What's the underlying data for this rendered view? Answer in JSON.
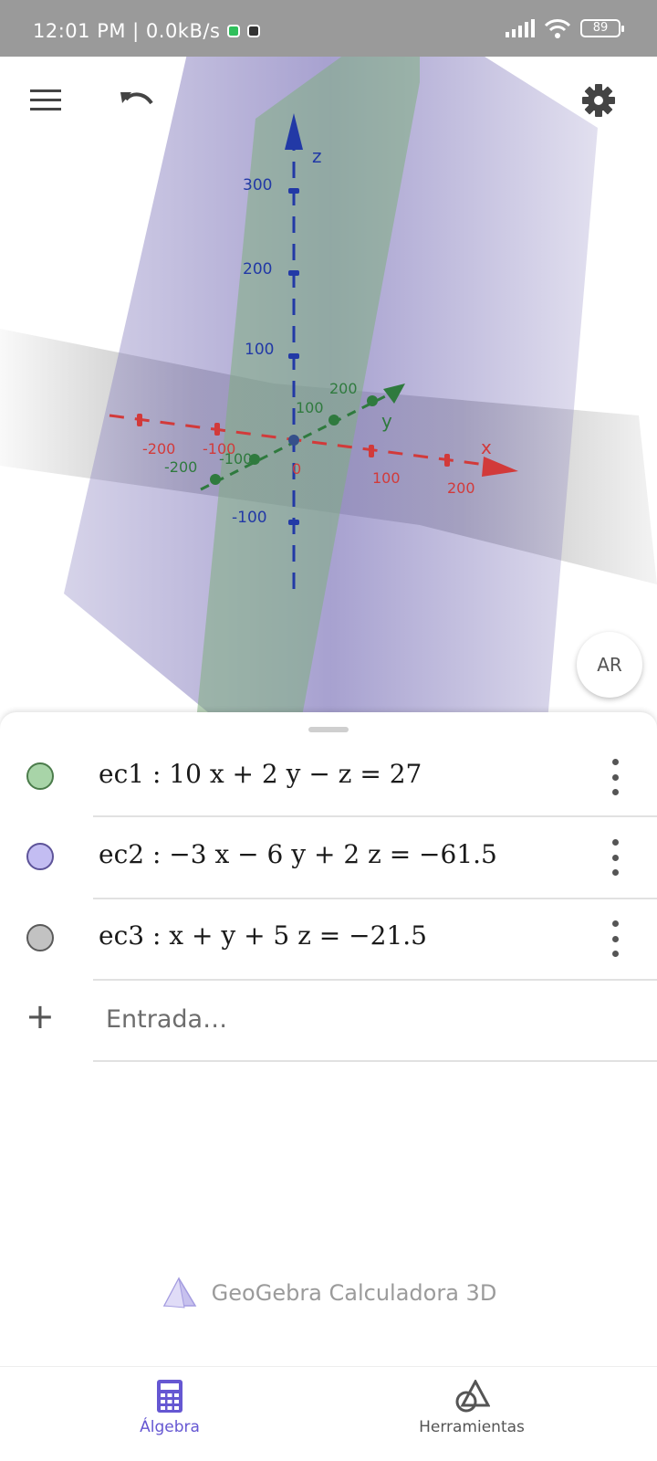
{
  "status_bar": {
    "time_speed": "12:01 PM | 0.0kB/s",
    "battery": "89"
  },
  "toolbar": {
    "menu_icon": "hamburger-menu-icon",
    "undo_icon": "undo-icon",
    "settings_icon": "gear-icon"
  },
  "viewport": {
    "axes": {
      "z_label": "z",
      "y_label": "y",
      "x_label": "x",
      "origin_label": "0",
      "z_ticks": [
        "300",
        "200",
        "100",
        "-100"
      ],
      "y_ticks": [
        "200",
        "100",
        "-100",
        "-200"
      ],
      "x_ticks": [
        "-200",
        "-100",
        "100",
        "200"
      ]
    },
    "colors": {
      "plane_ec1": "#7fae7f",
      "plane_ec2": "#8e86c4",
      "plane_ec3": "#9a9a9a",
      "axis_x": "#d23a3a",
      "axis_y": "#2f7a3e",
      "axis_z": "#2239a6"
    },
    "ar_button": "AR"
  },
  "algebra": {
    "equations": [
      {
        "name": "ec1",
        "expression": "ec1 : 10 x + 2 y − z  =  27",
        "color": "#a8d4a8",
        "border": "#4b7c4b"
      },
      {
        "name": "ec2",
        "expression": "ec2 : −3 x − 6 y + 2 z  =  −61.5",
        "color": "#c3bdf2",
        "border": "#5d5399"
      },
      {
        "name": "ec3",
        "expression": "ec3 : x + y + 5 z  =  −21.5",
        "color": "#c2c2c2",
        "border": "#5a5a5a"
      }
    ],
    "input_placeholder": "Entrada…",
    "plus_symbol": "+"
  },
  "branding": {
    "app_name": "GeoGebra Calculadora 3D"
  },
  "bottom_nav": {
    "items": [
      {
        "label": "Álgebra",
        "icon": "calculator-icon",
        "active": true
      },
      {
        "label": "Herramientas",
        "icon": "tools-icon",
        "active": false
      }
    ]
  }
}
